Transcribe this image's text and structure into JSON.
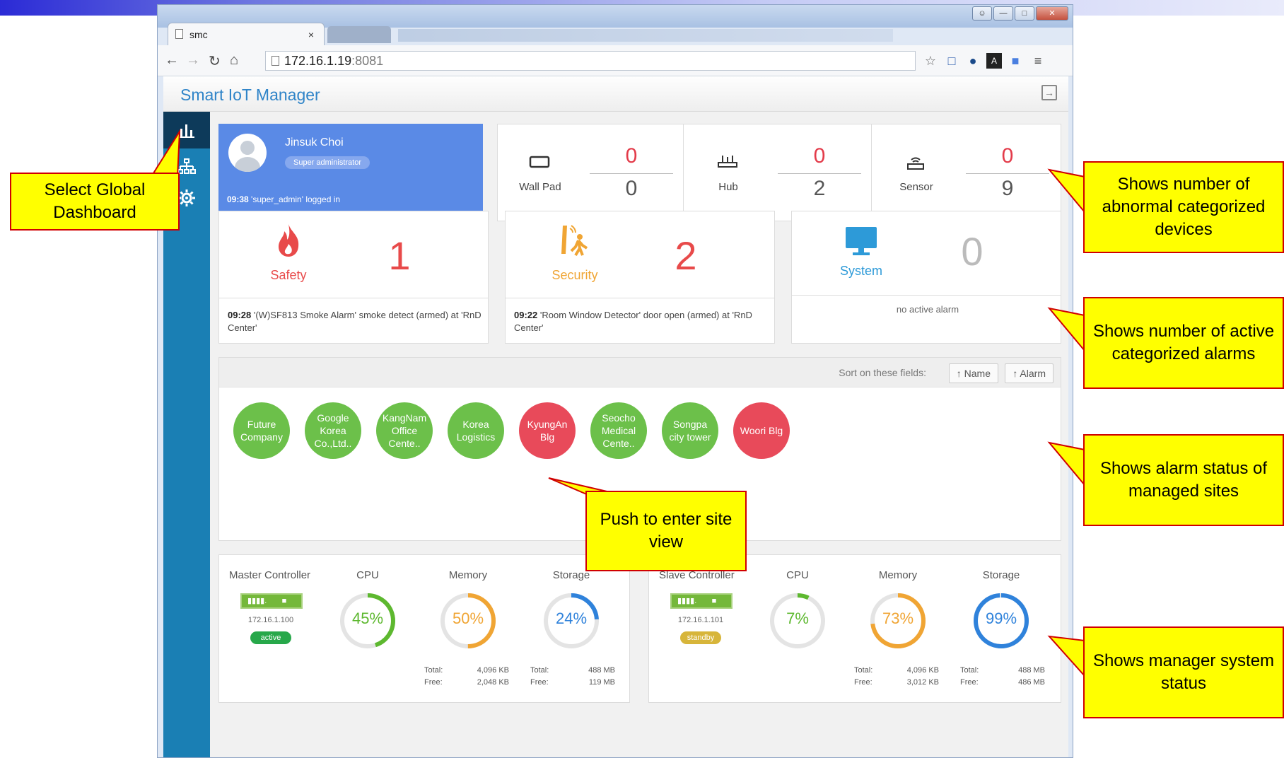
{
  "browser": {
    "tab_title": "smc",
    "tab_close": "×",
    "url_host": "172.16.1.19",
    "url_port": ":8081"
  },
  "app": {
    "title": "Smart IoT Manager"
  },
  "user": {
    "name": "Jinsuk Choi",
    "role": "Super administrator",
    "log_time": "09:38",
    "log_text": "'super_admin' logged in"
  },
  "devices": [
    {
      "label": "Wall Pad",
      "abnormal": "0",
      "total": "0"
    },
    {
      "label": "Hub",
      "abnormal": "0",
      "total": "2"
    },
    {
      "label": "Sensor",
      "abnormal": "0",
      "total": "9"
    }
  ],
  "alarms": [
    {
      "label": "Safety",
      "count": "1",
      "time": "09:28",
      "message": "'(W)SF813 Smoke Alarm' smoke detect (armed) at 'RnD Center'",
      "color": "#e84a4a"
    },
    {
      "label": "Security",
      "count": "2",
      "time": "09:22",
      "message": "'Room Window Detector' door open (armed) at 'RnD Center'",
      "color": "#f0a534"
    },
    {
      "label": "System",
      "count": "0",
      "time": "",
      "message": "no active alarm",
      "color": "#2d9ad8"
    }
  ],
  "sort": {
    "label": "Sort on these fields:",
    "name_btn": "↑ Name",
    "alarm_btn": "↑ Alarm"
  },
  "sites": [
    {
      "name": "Future Company",
      "status": "normal"
    },
    {
      "name": "Google Korea Co.,Ltd..",
      "status": "normal"
    },
    {
      "name": "KangNam Office Cente..",
      "status": "normal"
    },
    {
      "name": "Korea Logistics",
      "status": "normal"
    },
    {
      "name": "KyungAn Blg",
      "status": "alarm"
    },
    {
      "name": "Seocho Medical Cente..",
      "status": "normal"
    },
    {
      "name": "Songpa city tower",
      "status": "normal"
    },
    {
      "name": "Woori Blg",
      "status": "alarm"
    }
  ],
  "colors": {
    "normal": "#6cc04a",
    "alarm": "#e84a5a",
    "cpu": "#5db82f",
    "memory": "#f0a534",
    "storage": "#2f82db",
    "accent": "#2f84c8"
  },
  "controllers": [
    {
      "title": "Master Controller",
      "ip": "172.16.1.100",
      "state": "active",
      "state_color": "#27a84a",
      "cpu_label": "CPU",
      "cpu": "45%",
      "cpu_frac": 0.45,
      "memory_label": "Memory",
      "memory": "50%",
      "memory_frac": 0.5,
      "storage_label": "Storage",
      "storage": "24%",
      "storage_frac": 0.24,
      "mem_total_k": "Total:",
      "mem_total_v": "4,096 KB",
      "mem_free_k": "Free:",
      "mem_free_v": "2,048 KB",
      "sto_total_k": "Total:",
      "sto_total_v": "488 MB",
      "sto_free_k": "Free:",
      "sto_free_v": "119 MB"
    },
    {
      "title": "Slave Controller",
      "ip": "172.16.1.101",
      "state": "standby",
      "state_color": "#d7b53a",
      "cpu_label": "CPU",
      "cpu": "7%",
      "cpu_frac": 0.07,
      "memory_label": "Memory",
      "memory": "73%",
      "memory_frac": 0.73,
      "storage_label": "Storage",
      "storage": "99%",
      "storage_frac": 0.99,
      "mem_total_k": "Total:",
      "mem_total_v": "4,096 KB",
      "mem_free_k": "Free:",
      "mem_free_v": "3,012 KB",
      "sto_total_k": "Total:",
      "sto_total_v": "488 MB",
      "sto_free_k": "Free:",
      "sto_free_v": "486 MB"
    }
  ],
  "callouts": {
    "dashboard": "Select Global Dashboard",
    "abnormal": "Shows number of abnormal categorized devices",
    "alarms": "Shows number of active categorized alarms",
    "sites": "Shows alarm status of managed sites",
    "site_view": "Push to enter site view",
    "system": "Shows manager system status"
  }
}
